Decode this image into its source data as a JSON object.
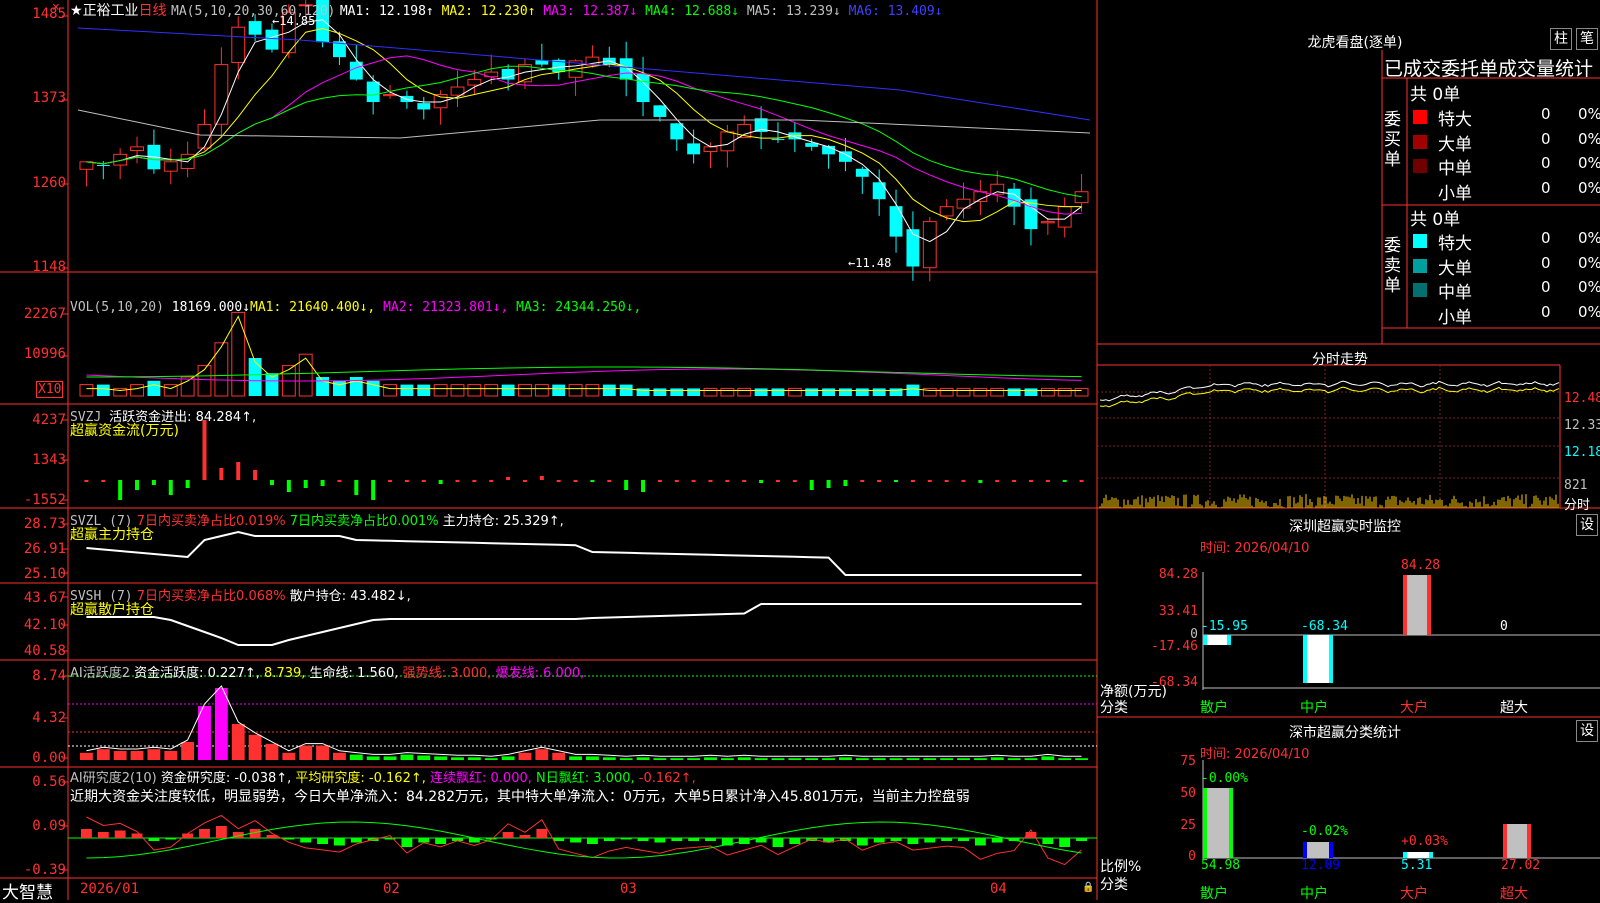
{
  "stock": {
    "name": "正裕工业",
    "period": "日线",
    "star": "★"
  },
  "main": {
    "ma_prefix": "MA(5,10,20,30,60,120)",
    "ma": [
      {
        "label": "MA1: 12.198↑",
        "color": "#ffffff"
      },
      {
        "label": "MA2: 12.230↑",
        "color": "#ffff00"
      },
      {
        "label": "MA3: 12.387↓",
        "color": "#ff00ff"
      },
      {
        "label": "MA4: 12.688↓",
        "color": "#00ff00"
      },
      {
        "label": "MA5: 13.239↓",
        "color": "#c0c0c0"
      },
      {
        "label": "MA6: 13.409↓",
        "color": "#4040ff"
      }
    ],
    "axis": [
      "1485",
      "1373",
      "1260",
      "1148"
    ],
    "high_mark": "←14.85",
    "low_mark": "←11.48"
  },
  "vol": {
    "label": "VOL(5,10,20)",
    "value": "18169.000↓",
    "ma": [
      {
        "label": "MA1: 21640.400↓",
        "color": "#ffff00"
      },
      {
        "label": "MA2: 21323.801↓",
        "color": "#ff00ff"
      },
      {
        "label": "MA3: 24344.250↓",
        "color": "#00ff00"
      }
    ],
    "axis": [
      "22267",
      "10996",
      "X10"
    ]
  },
  "svzj": {
    "label": "SVZJ",
    "item": "活跃资金进出: 84.284↑,",
    "sub": "超赢资金流(万元)",
    "axis": [
      "4237",
      "1343",
      "-1552"
    ]
  },
  "svzl": {
    "label": "SVZL (7)",
    "a": "7日内买卖净占比0.019%",
    "b": "7日内买卖净占比0.001%",
    "c": "主力持仓: 25.329↑,",
    "sub": "超赢主力持仓",
    "axis": [
      "28.73",
      "26.91",
      "25.10"
    ]
  },
  "svsh": {
    "label": "SVSH (7)",
    "a": "7日内买卖净占比0.068%",
    "c": "散户持仓: 43.482↓,",
    "sub": "超赢散户持仓",
    "axis": [
      "43.67",
      "42.10",
      "40.58"
    ]
  },
  "ai1": {
    "label": "AI活跃度2",
    "a": "资金活跃度: 0.227↑,",
    "b": "8.739,",
    "c": "生命线: 1.560,",
    "d": "强势线: 3.000,",
    "e": "爆发线: 6.000,",
    "axis": [
      "8.74",
      "4.32",
      "0.00"
    ]
  },
  "ai2": {
    "label": "AI研究度2(10)",
    "a": "资金研究度: -0.038↑,",
    "b": "平均研究度: -0.162↑,",
    "c": "连续飘红: 0.000,",
    "d": "N日飘红: 3.000,",
    "e": "-0.162↑,",
    "comment": "近期大资金关注度较低，明显弱势，今日大单净流入：84.282万元，其中特大单净流入：0万元，大单5日累计净入45.801万元，当前主力控盘弱",
    "axis": [
      "0.56",
      "0.09",
      "-0.39"
    ]
  },
  "bottom": {
    "brand": "大智慧",
    "dates": [
      "2026/01",
      "02",
      "03",
      "04"
    ]
  },
  "right": {
    "longhu_title": "龙虎看盘(逐单)",
    "btn1": "柱",
    "btn2": "笔",
    "tabs": "已成交委托单成交量统计",
    "buy_total": "共 0单",
    "buy_label": "委买单",
    "sell_total": "共 0单",
    "sell_label": "委卖单",
    "buy_rows": [
      {
        "name": "特大",
        "count": "0",
        "pct": "0%",
        "color": "#ff0000"
      },
      {
        "name": "大单",
        "count": "0",
        "pct": "0%",
        "color": "#a00000"
      },
      {
        "name": "中单",
        "count": "0",
        "pct": "0%",
        "color": "#700000"
      },
      {
        "name": "小单",
        "count": "0",
        "pct": "0%",
        "color": ""
      }
    ],
    "sell_rows": [
      {
        "name": "特大",
        "count": "0",
        "pct": "0%",
        "color": "#00ffff"
      },
      {
        "name": "大单",
        "count": "0",
        "pct": "0%",
        "color": "#00a0a0"
      },
      {
        "name": "中单",
        "count": "0",
        "pct": "0%",
        "color": "#007070"
      },
      {
        "name": "小单",
        "count": "0",
        "pct": "0%",
        "color": ""
      }
    ],
    "fenshi_title": "分时走势",
    "fenshi_axis": [
      "12.48",
      "12.33",
      "12.18",
      "821"
    ],
    "fenshi_sub": "分时",
    "sz_title": "深圳超赢实时监控",
    "sz_btn": "设",
    "sz_time": "时间: 2026/04/10",
    "sz_axis": [
      "84.28",
      "33.41",
      "0",
      "-17.46",
      "-68.34"
    ],
    "sz_values": [
      "-15.95",
      "-68.34",
      "84.28",
      "0"
    ],
    "sz_ylabel": "净额(万元)",
    "sz_cat_label": "分类",
    "cats": [
      "散户",
      "中户",
      "大户",
      "超大"
    ],
    "fl_title": "深市超赢分类统计",
    "fl_btn": "设",
    "fl_time": "时间: 2026/04/10",
    "fl_axis": [
      "75",
      "50",
      "25",
      "0"
    ],
    "fl_ylabel": "比例%",
    "fl_cat_label": "分类",
    "fl_pct": [
      "54.98",
      "12.09",
      "5.31",
      "27.02"
    ],
    "fl_chg": [
      "-0.00%",
      "-0.02%",
      "+0.03%"
    ]
  }
}
